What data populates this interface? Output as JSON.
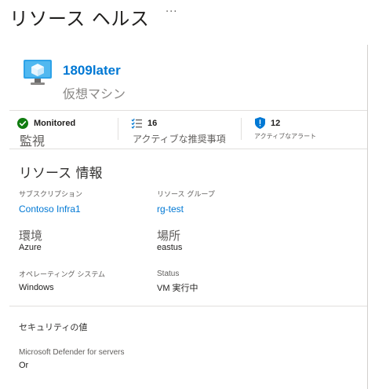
{
  "header": {
    "title": "リソース ヘルス",
    "more_label": "···"
  },
  "resource": {
    "name": "1809later",
    "type": "仮想マシン"
  },
  "stats": {
    "monitored": {
      "value": "Monitored",
      "label": "監視"
    },
    "recommendations": {
      "value": "16",
      "label": "アクティブな推奨事項"
    },
    "alerts": {
      "value": "12",
      "label": "アクティブなアラート"
    }
  },
  "resource_info": {
    "title": "リソース 情報",
    "subscription": {
      "label": "サブスクリプション",
      "value": "Contoso Infra1"
    },
    "resource_group": {
      "label": "リソース グループ",
      "value": "rg-test"
    },
    "environment": {
      "label": "環境",
      "value": "Azure"
    },
    "location": {
      "label": "場所",
      "value": "eastus"
    },
    "os": {
      "label": "オペレーティング システム",
      "value": "Windows"
    },
    "status": {
      "label": "Status",
      "value": "VM 実行中"
    }
  },
  "security": {
    "title": "セキュリティの値",
    "defender_label": "Microsoft Defender for servers",
    "defender_value": "Or"
  },
  "colors": {
    "accent": "#0078d4",
    "success": "#107c10",
    "shield": "#0078d4"
  }
}
